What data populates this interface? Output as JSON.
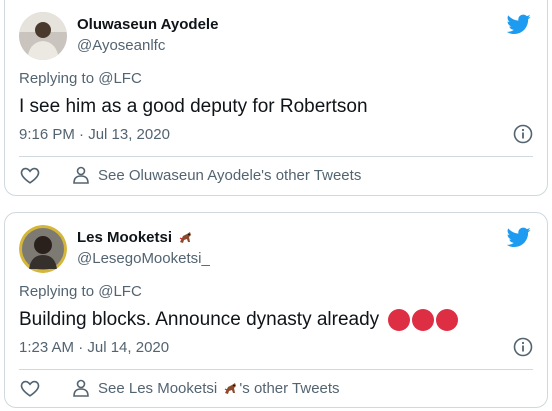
{
  "tweets": [
    {
      "name": "Oluwaseun Ayodele",
      "handle": "@Ayoseanlfc",
      "replying": "Replying to @LFC",
      "text": "I see him as a good deputy for Robertson",
      "time": "9:16 PM · Jul 13, 2020",
      "other_tweets": "See Oluwaseun Ayodele's other Tweets"
    },
    {
      "name": "Les Mooketsi",
      "handle": "@LesegoMooketsi_",
      "replying": "Replying to @LFC",
      "text": "Building blocks. Announce dynasty already",
      "time": "1:23 AM · Jul 14, 2020",
      "other_prefix": "See Les Mooketsi",
      "other_suffix": "'s other Tweets"
    }
  ],
  "colors": {
    "twitter_blue": "#1d9bf0",
    "muted": "#536471",
    "border": "#cfd9de",
    "red_circle": "#dd2e44"
  },
  "icons": [
    "twitter-bird-icon",
    "info-icon",
    "heart-icon",
    "person-icon",
    "horse-emoji-icon",
    "red-circle-emoji"
  ]
}
